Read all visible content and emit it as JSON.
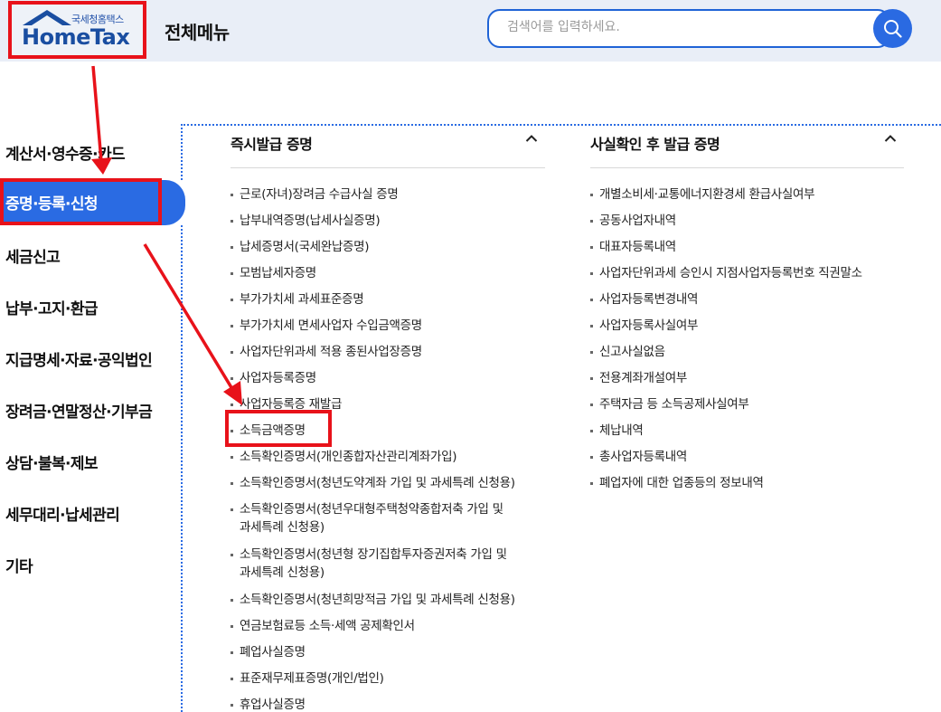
{
  "header": {
    "logo_sub": "국세청홈택스",
    "logo_main": "HomeTax",
    "menu_title": "전체메뉴",
    "search_placeholder": "검색어를 입력하세요."
  },
  "nav": {
    "items": [
      {
        "label": "계산서·영수증·카드"
      },
      {
        "label": "증명·등록·신청"
      },
      {
        "label": "세금신고"
      },
      {
        "label": "납부·고지·환급"
      },
      {
        "label": "지급명세·자료·공익법인"
      },
      {
        "label": "장려금·연말정산·기부금"
      },
      {
        "label": "상담·불복·제보"
      },
      {
        "label": "세무대리·납세관리"
      },
      {
        "label": "기타"
      }
    ],
    "active_index": 1
  },
  "columns": {
    "left": {
      "title": "즉시발급 증명",
      "items": [
        "근로(자녀)장려금 수급사실 증명",
        "납부내역증명(납세사실증명)",
        "납세증명서(국세완납증명)",
        "모범납세자증명",
        "부가가치세 과세표준증명",
        "부가가치세 면세사업자 수입금액증명",
        "사업자단위과세 적용 종된사업장증명",
        "사업자등록증명",
        "사업자등록증 재발급",
        "소득금액증명",
        "소득확인증명서(개인종합자산관리계좌가입)",
        "소득확인증명서(청년도약계좌 가입 및 과세특례 신청용)",
        "소득확인증명서(청년우대형주택청약종합저축 가입 및",
        "과세특례 신청용)",
        "소득확인증명서(청년형 장기집합투자증권저축 가입 및",
        "과세특례 신청용)",
        "소득확인증명서(청년희망적금 가입 및 과세특례 신청용)",
        "연금보험료등 소득·세액 공제확인서",
        "폐업사실증명",
        "표준재무제표증명(개인/법인)",
        "휴업사실증명"
      ]
    },
    "right": {
      "title": "사실확인 후 발급 증명",
      "items": [
        "개별소비세·교통에너지환경세 환급사실여부",
        "공동사업자내역",
        "대표자등록내역",
        "사업자단위과세 승인시 지점사업자등록번호 직권말소",
        "사업자등록변경내역",
        "사업자등록사실여부",
        "신고사실없음",
        "전용계좌개설여부",
        "주택자금 등 소득공제사실여부",
        "체납내역",
        "총사업자등록내역",
        "폐업자에 대한 업종등의 정보내역"
      ]
    }
  },
  "colors": {
    "accent": "#2a6be3",
    "highlight": "#e8121a",
    "header_bg": "#e9eef7"
  }
}
